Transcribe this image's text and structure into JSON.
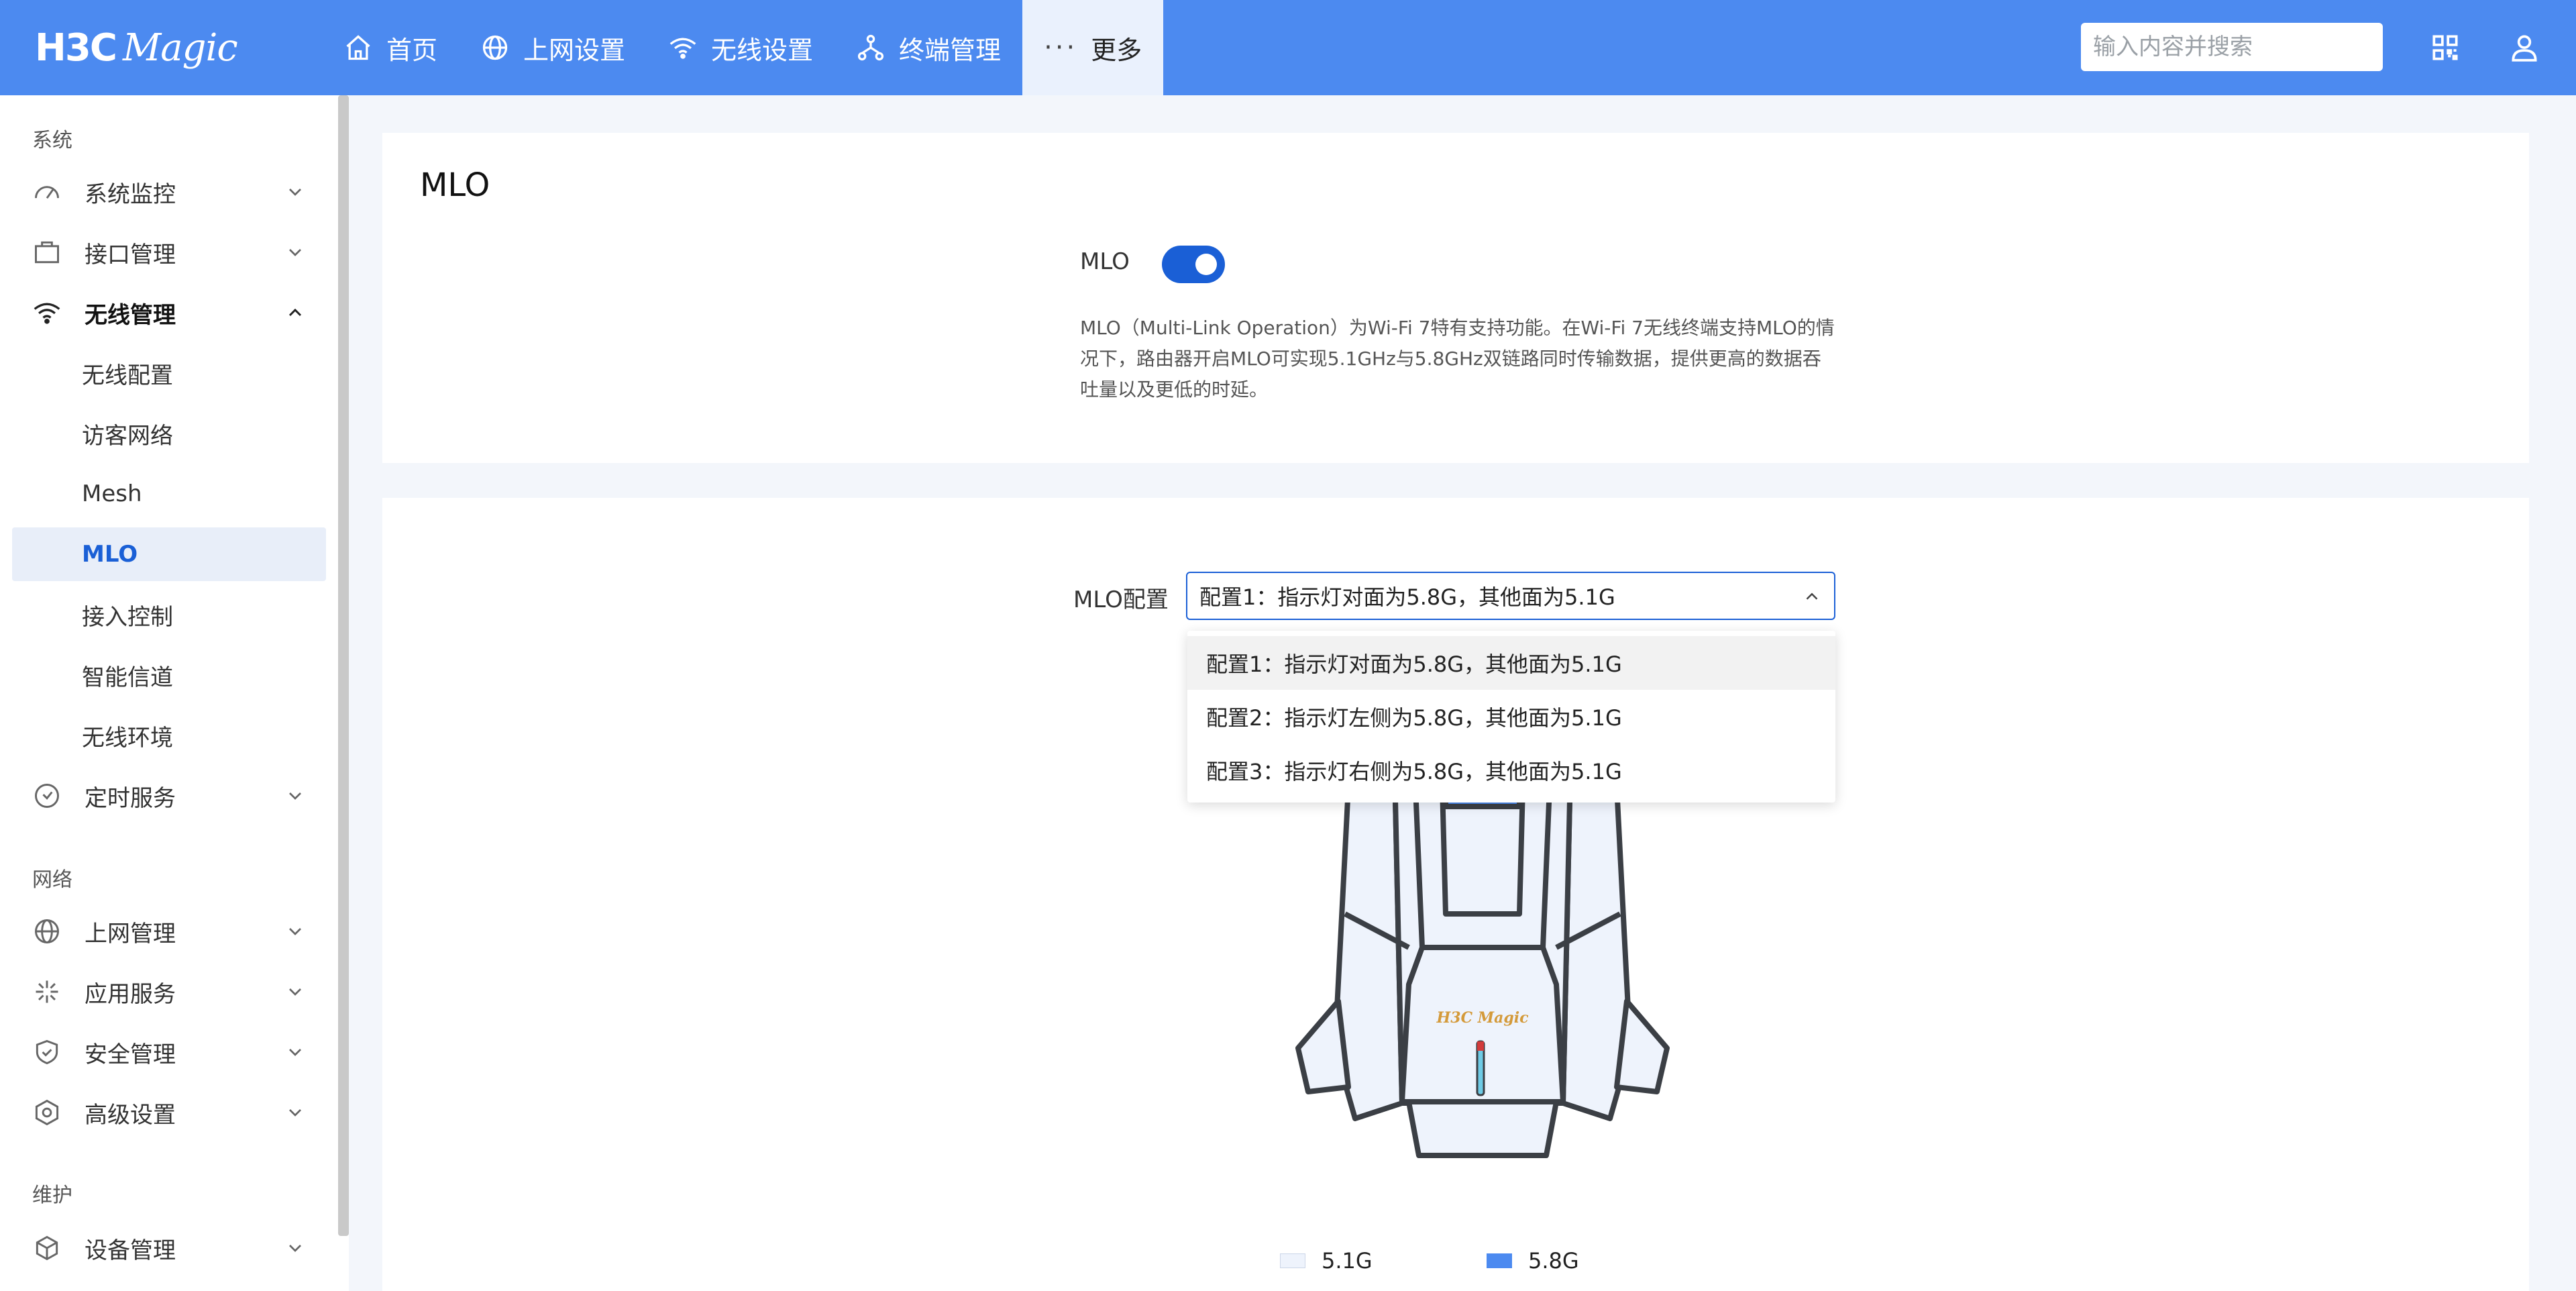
{
  "header": {
    "logo_main": "H3C",
    "logo_sub": "Magic",
    "nav": [
      {
        "label": "首页",
        "icon": "home-icon"
      },
      {
        "label": "上网设置",
        "icon": "globe-icon"
      },
      {
        "label": "无线设置",
        "icon": "wifi-icon"
      },
      {
        "label": "终端管理",
        "icon": "network-icon"
      },
      {
        "label": "更多",
        "icon": "more-icon"
      }
    ],
    "search_placeholder": "输入内容并搜索"
  },
  "sidebar": {
    "sections": {
      "system": "系统",
      "network": "网络",
      "maintenance": "维护"
    },
    "menu": {
      "monitor": "系统监控",
      "interface": "接口管理",
      "wireless": "无线管理",
      "timer": "定时服务",
      "internet": "上网管理",
      "apps": "应用服务",
      "security": "安全管理",
      "advanced": "高级设置",
      "device": "设备管理"
    },
    "wireless_sub": [
      "无线配置",
      "访客网络",
      "Mesh",
      "MLO",
      "接入控制",
      "智能信道",
      "无线环境"
    ],
    "active_sub": "MLO"
  },
  "main": {
    "title": "MLO",
    "toggle_label": "MLO",
    "toggle_on": true,
    "description": "MLO（Multi-Link Operation）为Wi-Fi 7特有支持功能。在Wi-Fi 7无线终端支持MLO的情况下，路由器开启MLO可实现5.1GHz与5.8GHz双链路同时传输数据，提供更高的数据吞吐量以及更低的时延。",
    "config_label": "MLO配置",
    "selected_config": "配置1：指示灯对面为5.8G，其他面为5.1G",
    "options": [
      "配置1：指示灯对面为5.8G，其他面为5.1G",
      "配置2：指示灯左侧为5.8G，其他面为5.1G",
      "配置3：指示灯右侧为5.8G，其他面为5.1G"
    ],
    "router_logo": "H3C Magic",
    "legend": [
      {
        "label": "5.1G",
        "color": "#eef3fc"
      },
      {
        "label": "5.8G",
        "color": "#4c8af0"
      }
    ]
  },
  "colors": {
    "header": "#4c8af0",
    "accent": "#1a5fd6",
    "active_bg": "#e8eef9"
  }
}
